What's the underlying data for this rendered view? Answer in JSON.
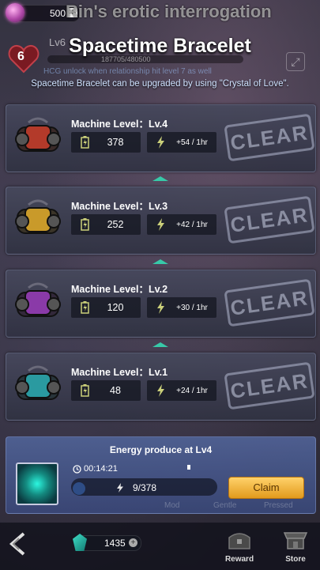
{
  "top": {
    "gems": "500",
    "bg_title": "Rin's erotic interrogation",
    "heart_level": "6",
    "lv_text": "Lv6",
    "progress_text": "187705/480500",
    "hint": "HCG unlock when relationship hit level 7 as well"
  },
  "header": {
    "title": "Spacetime Bracelet",
    "subtitle": "Spacetime Bracelet can be upgraded by using \"Crystal of Love\"."
  },
  "machines": [
    {
      "label": "Machine Level：Lv.4",
      "battery": "378",
      "rate": "+54 / 1hr",
      "stamp": "CLEAR",
      "color": "#b33a2a"
    },
    {
      "label": "Machine Level：Lv.3",
      "battery": "252",
      "rate": "+42 / 1hr",
      "stamp": "CLEAR",
      "color": "#c99a2a"
    },
    {
      "label": "Machine Level：Lv.2",
      "battery": "120",
      "rate": "+30 / 1hr",
      "stamp": "CLEAR",
      "color": "#8a3aa8"
    },
    {
      "label": "Machine Level：Lv.1",
      "battery": "48",
      "rate": "+24 / 1hr",
      "stamp": "CLEAR",
      "color": "#2a9aa0"
    }
  ],
  "energy": {
    "title": "Energy produce at Lv4",
    "timer": "00:14:21",
    "value": "9/378",
    "claim_label": "Claim"
  },
  "tabs_ghost": [
    "Mod",
    "Gentle",
    "Pressed"
  ],
  "bottom": {
    "crystals": "1435",
    "reward_label": "Reward",
    "store_label": "Store"
  }
}
